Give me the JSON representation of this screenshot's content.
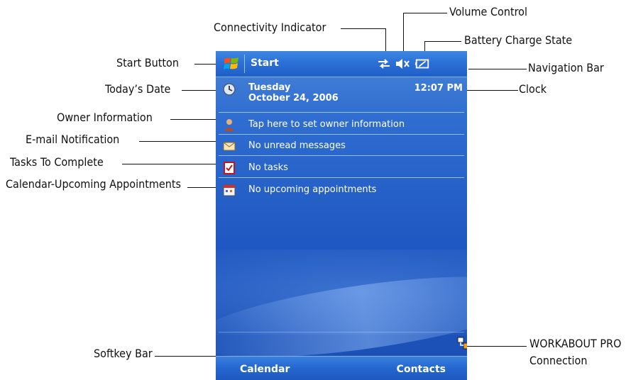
{
  "callouts": {
    "connectivity_indicator": "Connectivity Indicator",
    "volume_control": "Volume Control",
    "battery_charge_state": "Battery Charge State",
    "start_button": "Start Button",
    "navigation_bar": "Navigation Bar",
    "todays_date": "Today’s Date",
    "clock": "Clock",
    "owner_information": "Owner Information",
    "email_notification": "E-mail Notification",
    "tasks_to_complete": "Tasks To Complete",
    "calendar_upcoming": "Calendar-Upcoming Appointments",
    "softkey_bar": "Softkey Bar",
    "workabout_pro_line1": "WORKABOUT PRO",
    "workabout_pro_line2": "Connection"
  },
  "device": {
    "navbar": {
      "start_label": "Start",
      "icons": [
        "windows-logo-icon",
        "connectivity-icon",
        "volume-muted-icon",
        "battery-icon"
      ]
    },
    "today": {
      "day": "Tuesday",
      "date": "October 24, 2006",
      "time": "12:07 PM"
    },
    "items": [
      {
        "icon": "owner-icon",
        "text": "Tap here to set owner information"
      },
      {
        "icon": "mail-icon",
        "text": "No unread messages"
      },
      {
        "icon": "tasks-icon",
        "text": "No tasks"
      },
      {
        "icon": "calendar-icon",
        "text": "No upcoming appointments"
      }
    ],
    "softkeys": {
      "left": "Calendar",
      "right": "Contacts"
    },
    "connection_icon": "workabout-connection-icon"
  },
  "colors": {
    "background_blue": "#1e57c1",
    "bar_blue": "#2a6ed6",
    "text_white": "#ffffff"
  }
}
